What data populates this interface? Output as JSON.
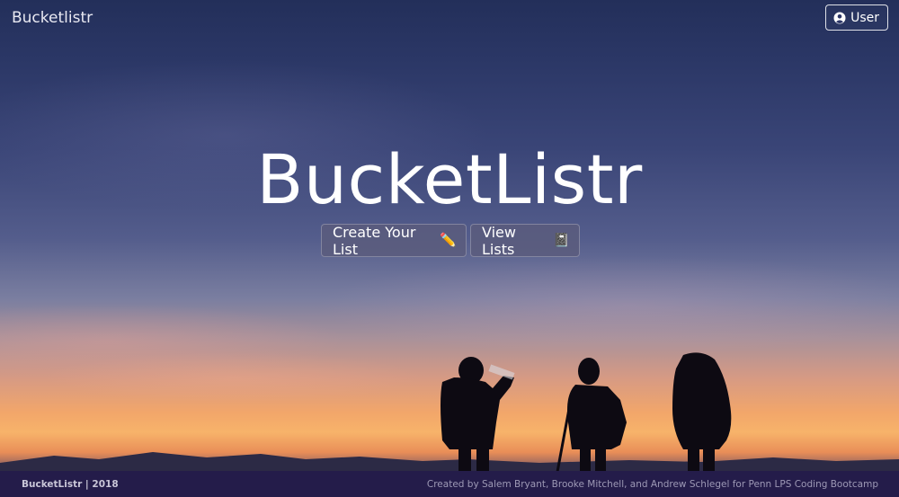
{
  "navbar": {
    "brand": "Bucketlistr",
    "user_button_label": "User",
    "user_icon": "user-circle-icon"
  },
  "hero": {
    "title": "BucketListr",
    "create_button_label": "Create Your List",
    "create_button_emoji": "✏️",
    "view_button_label": "View Lists",
    "view_button_emoji": "📓"
  },
  "footer": {
    "left": "BucketListr | 2018",
    "right": "Created by Salem Bryant, Brooke Mitchell, and Andrew Schlegel for Penn LPS Coding Bootcamp"
  },
  "colors": {
    "footer_bg": "#241c4a",
    "sky_top": "#232f5a",
    "sunset": "#f2a66a"
  }
}
